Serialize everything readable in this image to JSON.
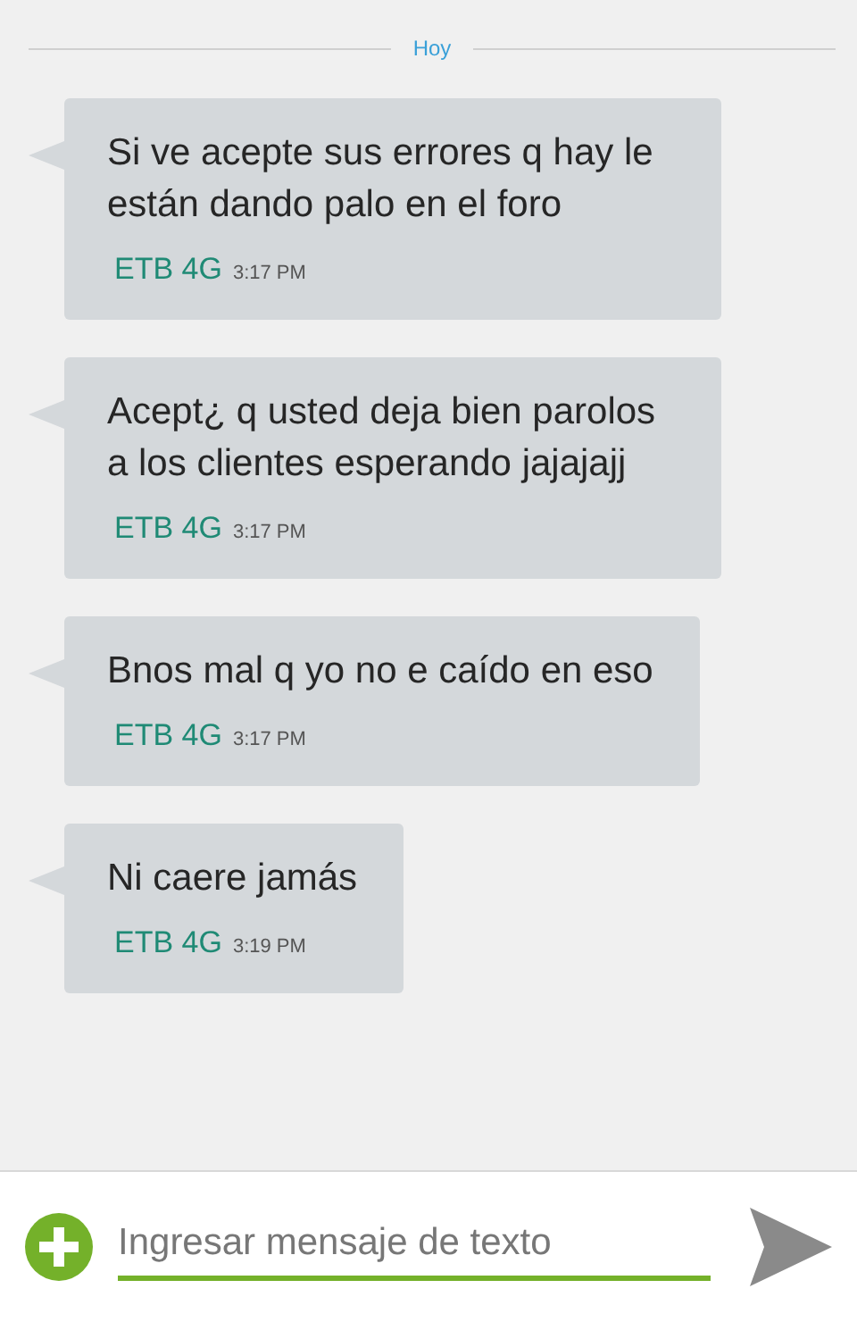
{
  "date_divider": "Hoy",
  "messages": [
    {
      "text": "Si ve acepte sus errores q hay le están dando palo en el foro",
      "sim": "ETB 4G",
      "time": "3:17 PM"
    },
    {
      "text": "Acept¿ q usted deja bien parolos a los clientes esperando jajajajj",
      "sim": "ETB 4G",
      "time": "3:17 PM"
    },
    {
      "text": "Bnos mal q yo no e caído en eso",
      "sim": "ETB 4G",
      "time": "3:17 PM"
    },
    {
      "text": "Ni caere jamás",
      "sim": "ETB 4G",
      "time": "3:19 PM"
    }
  ],
  "composer": {
    "placeholder": "Ingresar mensaje de texto"
  }
}
